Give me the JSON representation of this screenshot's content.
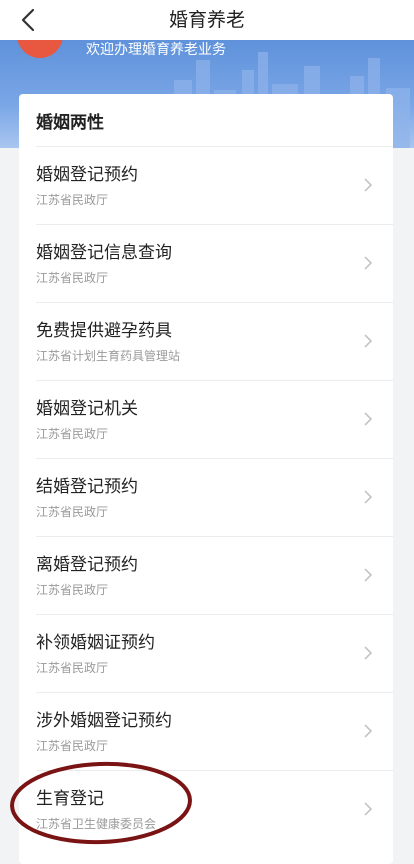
{
  "header": {
    "title": "婚育养老",
    "back_icon": "chevron-left-icon"
  },
  "banner": {
    "welcome": "欢迎办理婚育养老业务"
  },
  "section": {
    "title": "婚姻两性",
    "items": [
      {
        "name": "婚姻登记预约",
        "dept": "江苏省民政厅"
      },
      {
        "name": "婚姻登记信息查询",
        "dept": "江苏省民政厅"
      },
      {
        "name": "免费提供避孕药具",
        "dept": "江苏省计划生育药具管理站"
      },
      {
        "name": "婚姻登记机关",
        "dept": "江苏省民政厅"
      },
      {
        "name": "结婚登记预约",
        "dept": "江苏省民政厅"
      },
      {
        "name": "离婚登记预约",
        "dept": "江苏省民政厅"
      },
      {
        "name": "补领婚姻证预约",
        "dept": "江苏省民政厅"
      },
      {
        "name": "涉外婚姻登记预约",
        "dept": "江苏省民政厅"
      },
      {
        "name": "生育登记",
        "dept": "江苏省卫生健康委员会"
      }
    ]
  },
  "colors": {
    "banner": "#6b9be0",
    "annotation": "#7a1414"
  }
}
